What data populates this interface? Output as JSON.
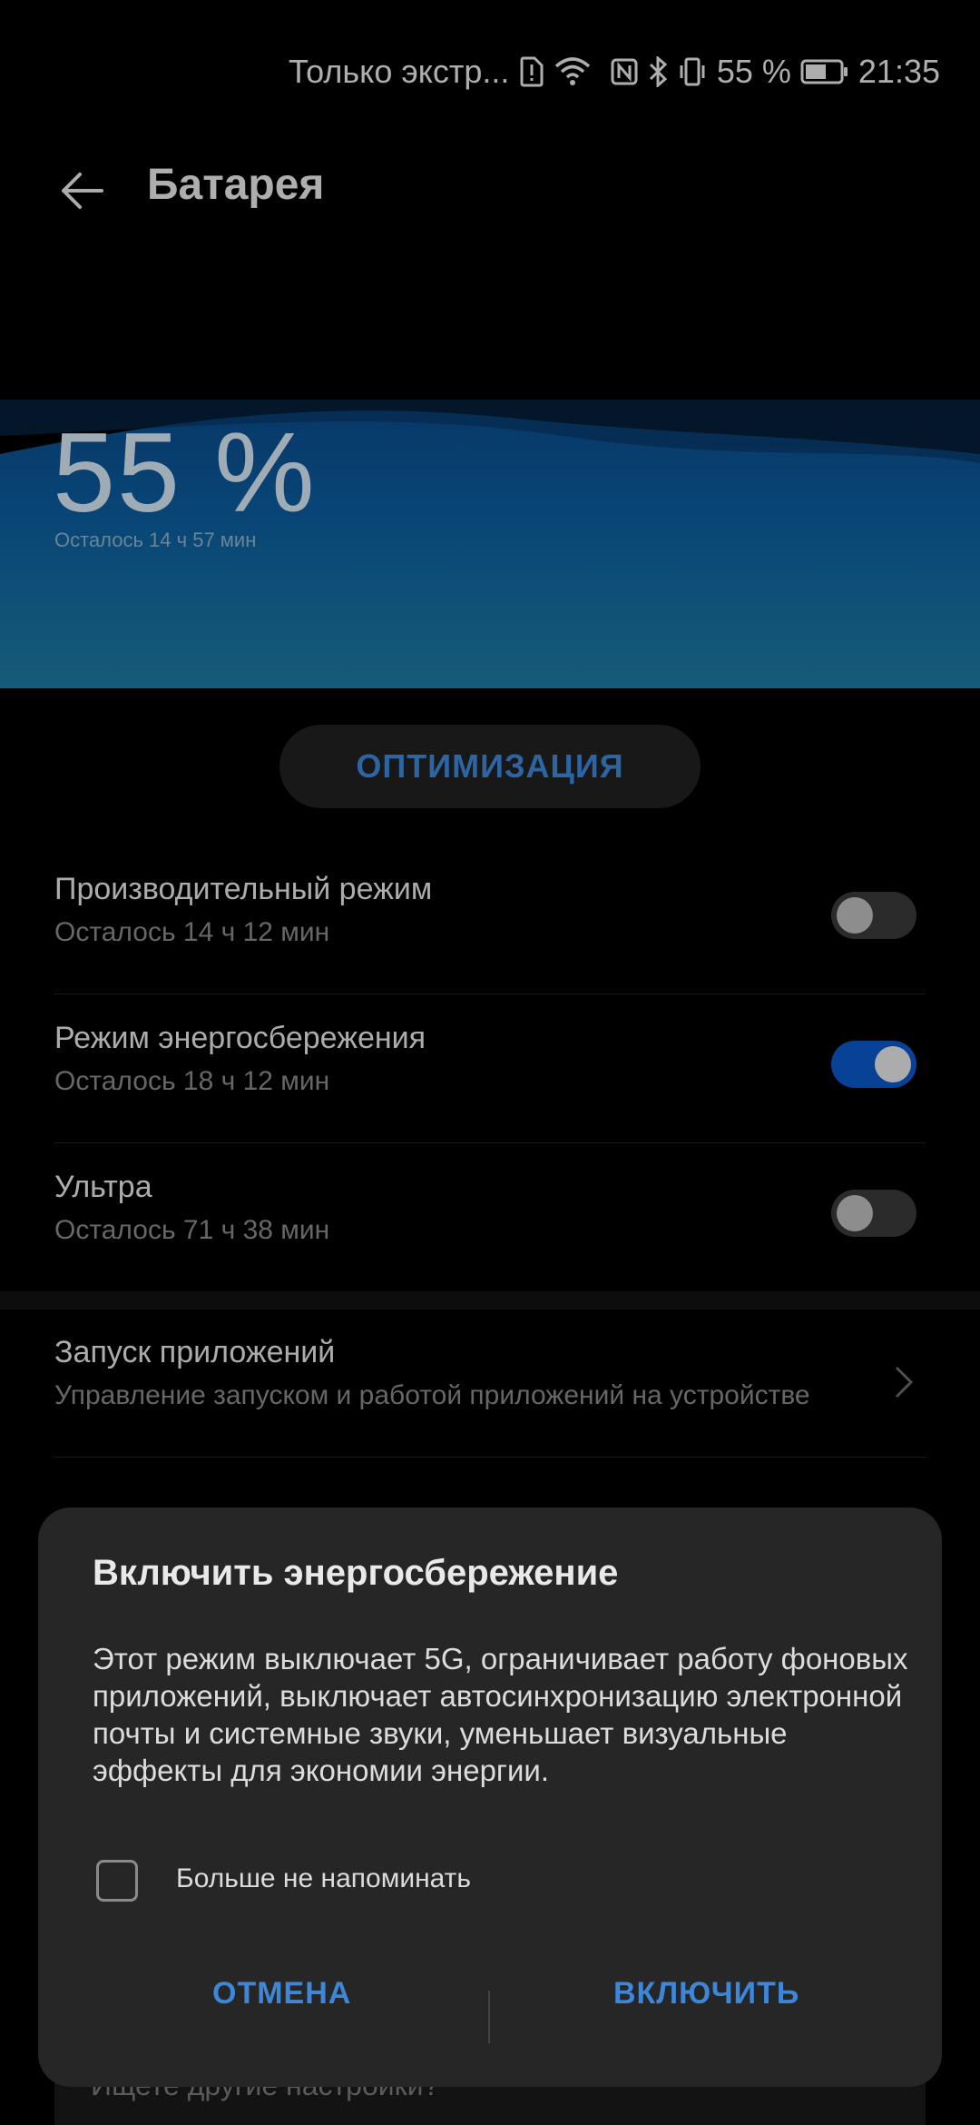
{
  "status_bar": {
    "carrier_text": "Только экстр...",
    "battery_percent": "55 %",
    "time": "21:35",
    "icons": [
      "sim-alert-icon",
      "wifi-icon",
      "nfc-icon",
      "bluetooth-icon",
      "vibrate-icon",
      "battery-icon"
    ]
  },
  "header": {
    "title": "Батарея"
  },
  "battery": {
    "percent": "55 %",
    "remaining": "Осталось 14 ч 57 мин"
  },
  "optimize_button": "ОПТИМИЗАЦИЯ",
  "modes": [
    {
      "title": "Производительный режим",
      "subtitle": "Осталось 14 ч 12 мин",
      "enabled": false
    },
    {
      "title": "Режим энергосбережения",
      "subtitle": "Осталось 18 ч 12 мин",
      "enabled": true
    },
    {
      "title": "Ультра",
      "subtitle": "Осталось 71 ч 38 мин",
      "enabled": false
    }
  ],
  "app_launch": {
    "title": "Запуск приложений",
    "subtitle": "Управление запуском и работой приложений на устройстве"
  },
  "footer_hint": "Ищете другие настройки?",
  "dialog": {
    "title": "Включить энергосбережение",
    "body": "Этот режим выключает 5G, ограничивает работу фоновых приложений, выключает автосинхронизацию электронной почты и системные звуки, уменьшает визуальные эффекты для экономии энергии.",
    "checkbox_label": "Больше не напоминать",
    "checkbox_checked": false,
    "cancel": "ОТМЕНА",
    "confirm": "ВКЛЮЧИТЬ"
  },
  "colors": {
    "accent": "#3d86d8",
    "toggle_on": "#0a58c9",
    "dialog_bg": "#262626"
  }
}
